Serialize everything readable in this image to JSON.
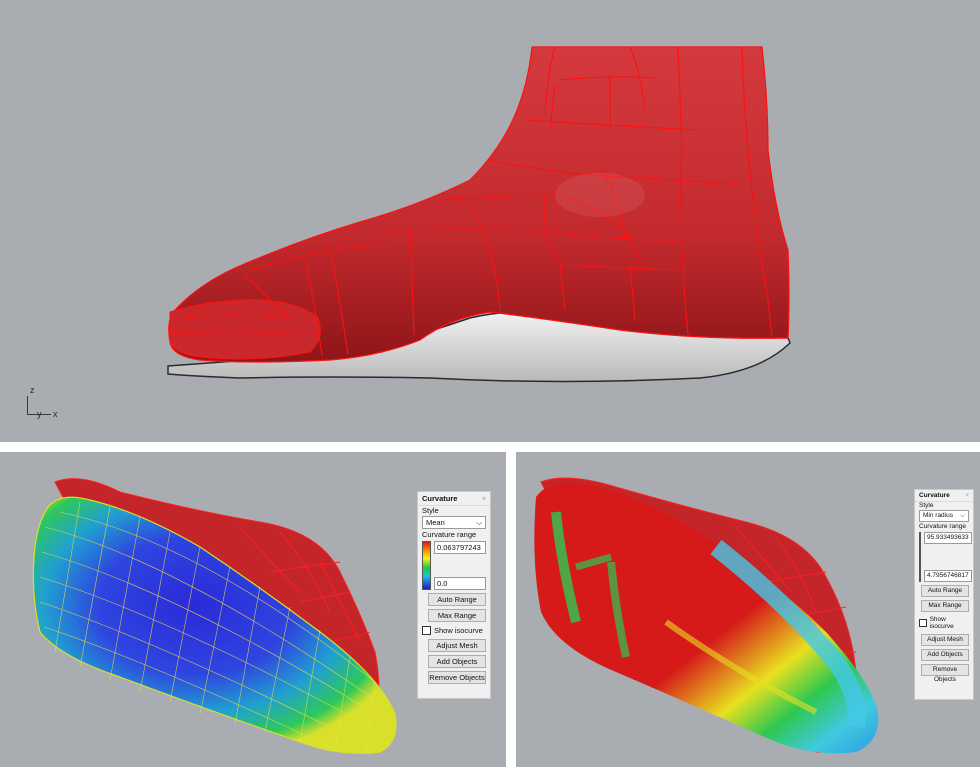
{
  "top_view": {
    "axis": {
      "z": "z",
      "y": "y",
      "x": "x"
    }
  },
  "mean_panel": {
    "title": "Curvature",
    "close": "×",
    "style_label": "Style",
    "style_value": "Mean",
    "range_label": "Curvature range",
    "max_value": "0.063797243",
    "min_value": "0.0",
    "auto_range": "Auto Range",
    "max_range": "Max Range",
    "show_isocurve": "Show isocurve",
    "adjust_mesh": "Adjust Mesh",
    "add_objects": "Add Objects",
    "remove_objects": "Remove Objects"
  },
  "radius_panel": {
    "title": "Curvature",
    "close": "×",
    "style_label": "Style",
    "style_value": "Min radius",
    "range_label": "Curvature range",
    "max_value": "95.933493633",
    "min_value": "4.7956746817",
    "auto_range": "Auto Range",
    "max_range": "Max Range",
    "show_isocurve": "Show isocurve",
    "adjust_mesh": "Adjust Mesh",
    "add_objects": "Add Objects",
    "remove_objects": "Remove Objects"
  },
  "colors": {
    "viewport_bg": "#a9adb2",
    "foot_red": "#c8262a",
    "isocurve_red": "#ff1010",
    "sole_grey": "#dcdcdc"
  }
}
